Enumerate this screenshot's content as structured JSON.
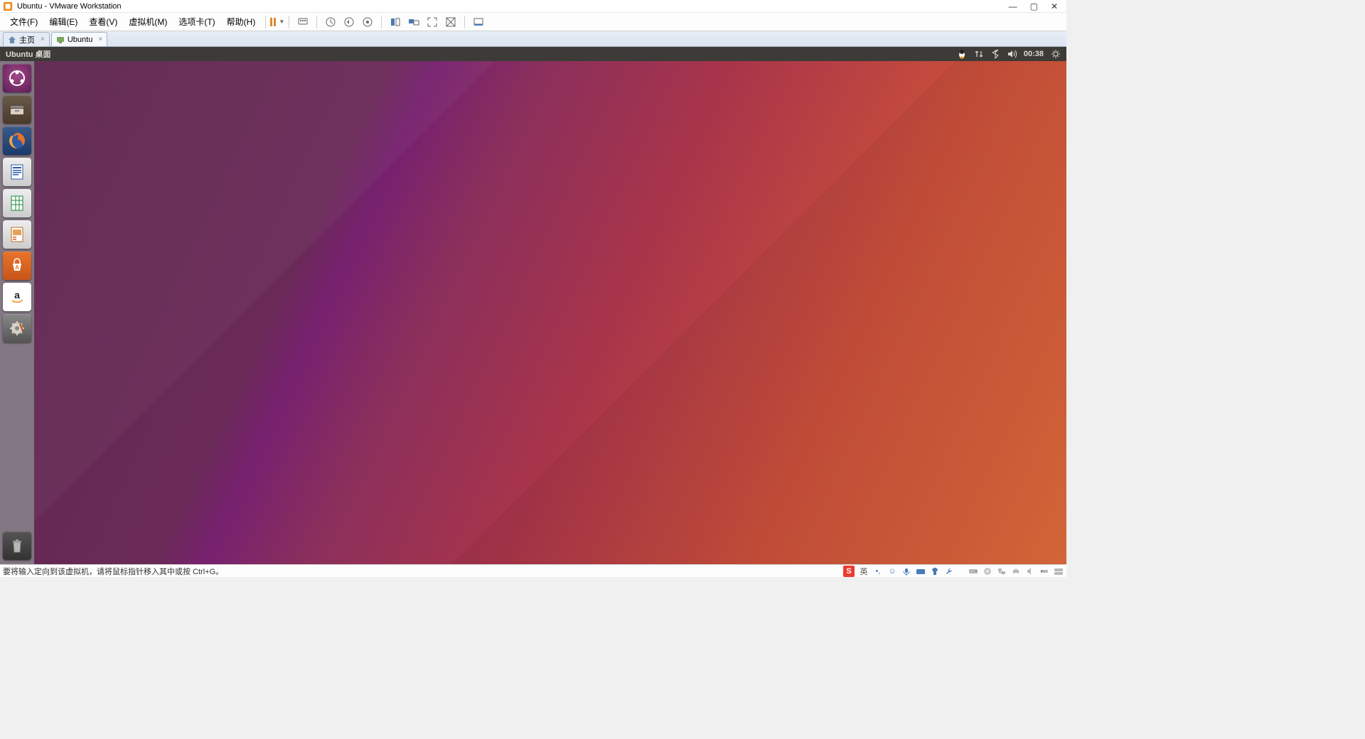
{
  "window": {
    "title": "Ubuntu - VMware Workstation"
  },
  "menubar": {
    "items": [
      "文件(F)",
      "编辑(E)",
      "查看(V)",
      "虚拟机(M)",
      "选项卡(T)",
      "帮助(H)"
    ]
  },
  "tabs": [
    {
      "label": "主页",
      "icon": "home"
    },
    {
      "label": "Ubuntu",
      "icon": "vm"
    }
  ],
  "ubuntu": {
    "topbar_title": "Ubuntu 桌面",
    "clock": "00:38",
    "launcher": [
      {
        "name": "dash",
        "label": "Dash"
      },
      {
        "name": "files",
        "label": "文件"
      },
      {
        "name": "firefox",
        "label": "Firefox"
      },
      {
        "name": "writer",
        "label": "LibreOffice Writer"
      },
      {
        "name": "calc",
        "label": "LibreOffice Calc"
      },
      {
        "name": "impress",
        "label": "LibreOffice Impress"
      },
      {
        "name": "software",
        "label": "Ubuntu 软件"
      },
      {
        "name": "amazon",
        "label": "Amazon"
      },
      {
        "name": "settings",
        "label": "系统设置"
      }
    ],
    "trash": "回收站"
  },
  "statusbar": {
    "message": "要将输入定向到该虚拟机，请将鼠标指针移入其中或按 Ctrl+G。",
    "ime_badge": "S",
    "ime_lang": "英"
  }
}
